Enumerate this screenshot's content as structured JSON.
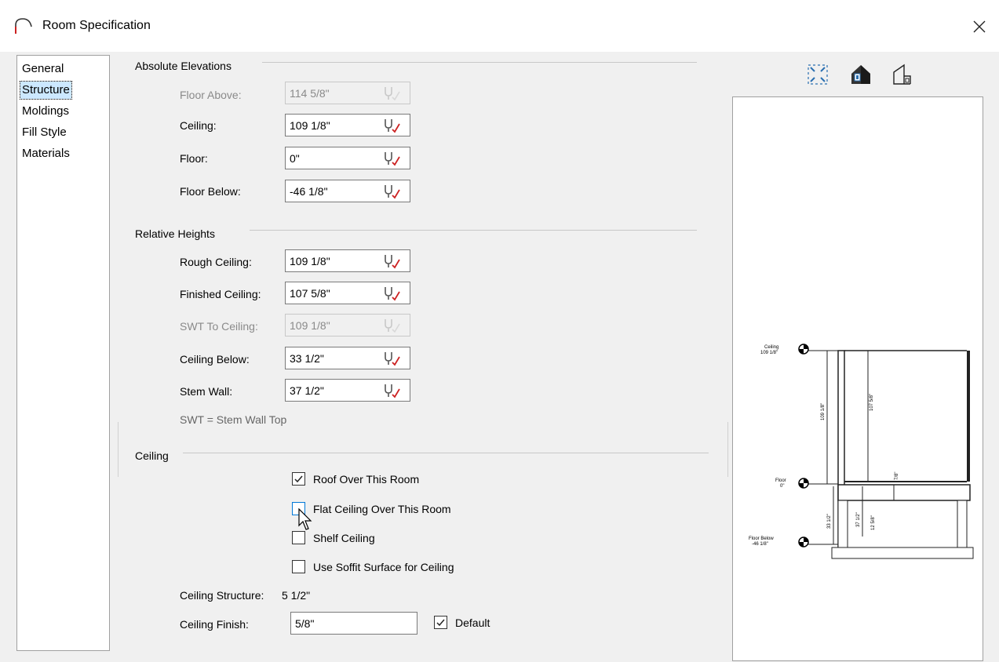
{
  "window": {
    "title": "Room Specification"
  },
  "nav": {
    "items": [
      "General",
      "Structure",
      "Moldings",
      "Fill Style",
      "Materials"
    ],
    "selected": "Structure"
  },
  "absolute": {
    "title": "Absolute Elevations",
    "floor_above": {
      "label": "Floor Above:",
      "value": "114 5/8\"",
      "disabled": true
    },
    "ceiling": {
      "label": "Ceiling:",
      "value": "109 1/8\""
    },
    "floor": {
      "label": "Floor:",
      "value": "0\""
    },
    "floor_below": {
      "label": "Floor Below:",
      "value": "-46 1/8\""
    }
  },
  "relative": {
    "title": "Relative Heights",
    "rough_ceiling": {
      "label": "Rough Ceiling:",
      "value": "109 1/8\""
    },
    "finished_ceiling": {
      "label": "Finished Ceiling:",
      "value": "107 5/8\""
    },
    "swt_to_ceiling": {
      "label": "SWT To Ceiling:",
      "value": "109 1/8\"",
      "disabled": true
    },
    "ceiling_below": {
      "label": "Ceiling Below:",
      "value": "33 1/2\""
    },
    "stem_wall": {
      "label": "Stem Wall:",
      "value": "37 1/2\""
    },
    "note": "SWT = Stem Wall Top"
  },
  "ceiling": {
    "title": "Ceiling",
    "roof_over": {
      "label": "Roof Over This Room",
      "checked": true
    },
    "flat_ceiling": {
      "label": "Flat Ceiling Over This Room",
      "checked": false
    },
    "shelf_ceiling": {
      "label": "Shelf Ceiling",
      "checked": false
    },
    "soffit": {
      "label": "Use Soffit Surface for Ceiling",
      "checked": false
    },
    "structure_label": "Ceiling Structure:",
    "structure_value": "5 1/2\"",
    "finish": {
      "label": "Ceiling Finish:",
      "value": "5/8\""
    },
    "default": {
      "label": "Default",
      "checked": true
    }
  },
  "preview": {
    "tools": [
      "fit-view-icon",
      "camera-view-icon",
      "elevation-view-icon"
    ],
    "labels": {
      "ceiling": "Ceiling",
      "ceiling_value": "109 1/8\"",
      "floor": "Floor",
      "floor_value": "0\"",
      "floor_below": "Floor Below",
      "floor_below_value": "-46 1/8\"",
      "dim_total": "109 1/8\"",
      "dim_finished": "107 5/8\"",
      "dim_finish": "7/8\"",
      "dim_stem": "33 1/2\"",
      "dim_ceiling_below": "37 1/2\"",
      "dim_footing": "12 5/8\""
    }
  },
  "colors": {
    "accent": "#0078d7",
    "check": "#cc2222",
    "title_icon": "#cc2222"
  }
}
